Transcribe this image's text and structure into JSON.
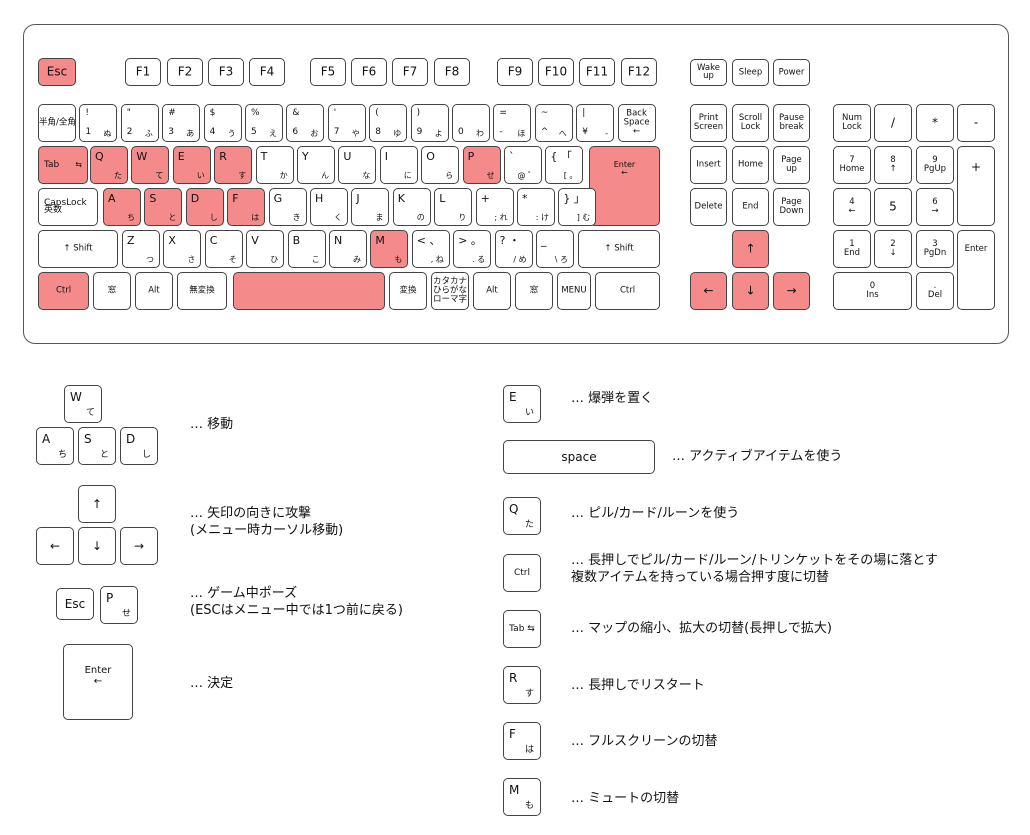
{
  "colors": {
    "highlight": "#f58a8a",
    "key_border": "#444444",
    "background": "#ffffff"
  },
  "keyboard": {
    "function_row": [
      "Esc",
      "F1",
      "F2",
      "F3",
      "F4",
      "F5",
      "F6",
      "F7",
      "F8",
      "F9",
      "F10",
      "F11",
      "F12"
    ],
    "power_keys": [
      "Wake\nup",
      "Sleep",
      "Power"
    ],
    "number_row": [
      {
        "t": "半角/全角 漢字"
      },
      {
        "m": "!",
        "b": "1",
        "k": "ぬ"
      },
      {
        "m": "\"",
        "b": "2",
        "k": "ふ"
      },
      {
        "m": "#",
        "b": "3",
        "k": "あ"
      },
      {
        "m": "$",
        "b": "4",
        "k": "う"
      },
      {
        "m": "%",
        "b": "5",
        "k": "え"
      },
      {
        "m": "&",
        "b": "6",
        "k": "お"
      },
      {
        "m": "'",
        "b": "7",
        "k": "や"
      },
      {
        "m": "(",
        "b": "8",
        "k": "ゆ"
      },
      {
        "m": ")",
        "b": "9",
        "k": "よ"
      },
      {
        "m": "",
        "b": "0",
        "k": "わ"
      },
      {
        "m": "=",
        "b": "-",
        "k": "ほ"
      },
      {
        "m": "~",
        "b": "^",
        "k": "へ"
      },
      {
        "m": "|",
        "b": "¥",
        "k": "-"
      },
      {
        "t": "Back\nSpace\n←"
      }
    ],
    "qwerty_row": [
      {
        "m": "Q",
        "k": "た"
      },
      {
        "m": "W",
        "k": "て"
      },
      {
        "m": "E",
        "k": "い"
      },
      {
        "m": "R",
        "k": "す"
      },
      {
        "m": "T",
        "k": "か"
      },
      {
        "m": "Y",
        "k": "ん"
      },
      {
        "m": "U",
        "k": "な"
      },
      {
        "m": "I",
        "k": "に"
      },
      {
        "m": "O",
        "k": "ら"
      },
      {
        "m": "P",
        "k": "せ"
      },
      {
        "m": "`",
        "k": "@ ゛"
      },
      {
        "m": "{ 「",
        "k": "[ 。"
      }
    ],
    "home_row": [
      {
        "m": "A",
        "k": "ち"
      },
      {
        "m": "S",
        "k": "と"
      },
      {
        "m": "D",
        "k": "し"
      },
      {
        "m": "F",
        "k": "は"
      },
      {
        "m": "G",
        "k": "き"
      },
      {
        "m": "H",
        "k": "く"
      },
      {
        "m": "J",
        "k": "ま"
      },
      {
        "m": "K",
        "k": "の"
      },
      {
        "m": "L",
        "k": "り"
      },
      {
        "m": "+",
        "k": "; れ"
      },
      {
        "m": "*",
        "k": ": け"
      },
      {
        "m": "} 」",
        "k": "] む"
      }
    ],
    "bottom_letter_row": [
      {
        "m": "Z",
        "k": "つ"
      },
      {
        "m": "X",
        "k": "さ"
      },
      {
        "m": "C",
        "k": "そ"
      },
      {
        "m": "V",
        "k": "ひ"
      },
      {
        "m": "B",
        "k": "こ"
      },
      {
        "m": "N",
        "k": "み"
      },
      {
        "m": "M",
        "k": "も"
      },
      {
        "m": "< 、",
        "k": ", ね"
      },
      {
        "m": "> 。",
        "k": ". る"
      },
      {
        "m": "? ・",
        "k": "/ め"
      },
      {
        "m": "_",
        "k": "\\ ろ"
      }
    ],
    "labels": {
      "tab": "Tab",
      "tab_arrows": "⇆",
      "capslock": "CapsLock",
      "capslock_sub": "英数",
      "shift": "↑ Shift",
      "enter": "Enter",
      "enter_arrow": "←",
      "ctrl": "Ctrl",
      "win": "窓",
      "alt": "Alt",
      "muhenkan": "無変換",
      "henkan": "変換",
      "kana": "カタカナ\nひらがな\nローマ字",
      "menu": "MENU"
    },
    "nav_keys": [
      "Print\nScreen",
      "Scroll\nLock",
      "Pause\nbreak",
      "Insert",
      "Home",
      "Page\nup",
      "Delete",
      "End",
      "Page\nDown"
    ],
    "arrows": {
      "up": "↑",
      "down": "↓",
      "left": "←",
      "right": "→"
    },
    "numpad": [
      "Num\nLock",
      "/",
      "*",
      "-",
      "7\nHome",
      "8\n↑",
      "9\nPgUp",
      "+",
      "4\n←",
      "5",
      "6\n→",
      "1\nEnd",
      "2\n↓",
      "3\nPgDn",
      "Enter",
      "0\nIns",
      ".\nDel"
    ]
  },
  "legend": [
    {
      "action": "… 移動"
    },
    {
      "action": "… 矢印の向きに攻撃\n(メニュー時カーソル移動)"
    },
    {
      "action": "… ゲーム中ポーズ\n(ESCはメニュー中では1つ前に戻る)"
    },
    {
      "action": "… 決定"
    },
    {
      "action": "… 爆弾を置く"
    },
    {
      "key": "space",
      "action": "… アクティブアイテムを使う"
    },
    {
      "action": "… ピル/カード/ルーンを使う"
    },
    {
      "action": "… 長押しでピル/カード/ルーン/トリンケットをその場に落とす\n複数アイテムを持っている場合押す度に切替"
    },
    {
      "action": "… マップの縮小、拡大の切替(長押しで拡大)"
    },
    {
      "action": "… 長押しでリスタート"
    },
    {
      "action": "… フルスクリーンの切替"
    },
    {
      "action": "… ミュートの切替"
    }
  ]
}
